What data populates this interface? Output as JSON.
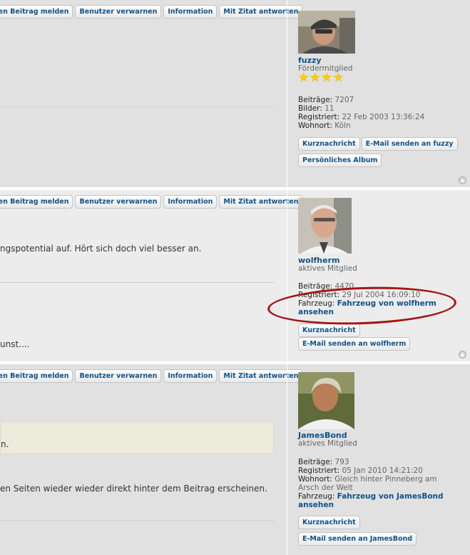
{
  "post_buttons": {
    "report": "sen Beitrag melden",
    "warn": "Benutzer verwarnen",
    "info": "Information",
    "quote": "Mit Zitat antworten"
  },
  "posts": [
    {
      "username": "fuzzy",
      "rank": "Fördermitglied",
      "stars": "★★★★",
      "details": {
        "posts_label": "Beiträge:",
        "posts_value": "7207",
        "pictures_label": "Bilder:",
        "pictures_value": "11",
        "registered_label": "Registriert:",
        "registered_value": "22 Feb 2003 13:36:24",
        "location_label": "Wohnort:",
        "location_value": "Köln"
      },
      "buttons": {
        "pm": "Kurznachricht",
        "email": "E-Mail senden an fuzzy",
        "album": "Persönliches Album"
      }
    },
    {
      "username": "wolfherm",
      "rank": "aktives Mitglied",
      "content_line1": "ngspotential auf. Hört sich doch viel besser an.",
      "content_line2": "unst....",
      "details": {
        "posts_label": "Beiträge:",
        "posts_value": "4470",
        "registered_label": "Registriert:",
        "registered_value": "29 Jul 2004 16:09:10",
        "vehicle_label": "Fahrzeug:",
        "vehicle_link": "Fahrzeug von wolfherm ansehen"
      },
      "buttons": {
        "pm": "Kurznachricht",
        "email": "E-Mail senden an wolfherm"
      }
    },
    {
      "username": "JamesBond",
      "rank": "aktives Mitglied",
      "quote_text": "n.",
      "content_line1": "en Seiten wieder wieder direkt hinter dem Beitrag erscheinen.",
      "details": {
        "posts_label": "Beiträge:",
        "posts_value": "793",
        "registered_label": "Registriert:",
        "registered_value": "05 Jan 2010 14:21:20",
        "location_label": "Wohnort:",
        "location_value": "Gleich hinter Pinneberg am Arsch der Welt",
        "vehicle_label": "Fahrzeug:",
        "vehicle_link": "Fahrzeug von JamesBond ansehen"
      },
      "buttons": {
        "pm": "Kurznachricht",
        "email": "E-Mail senden an JamesBond"
      }
    }
  ],
  "icons": {
    "top": "back-to-top-icon"
  },
  "colors": {
    "link": "#105289",
    "highlight_circle": "#a31515",
    "star": "#ffcc00"
  }
}
